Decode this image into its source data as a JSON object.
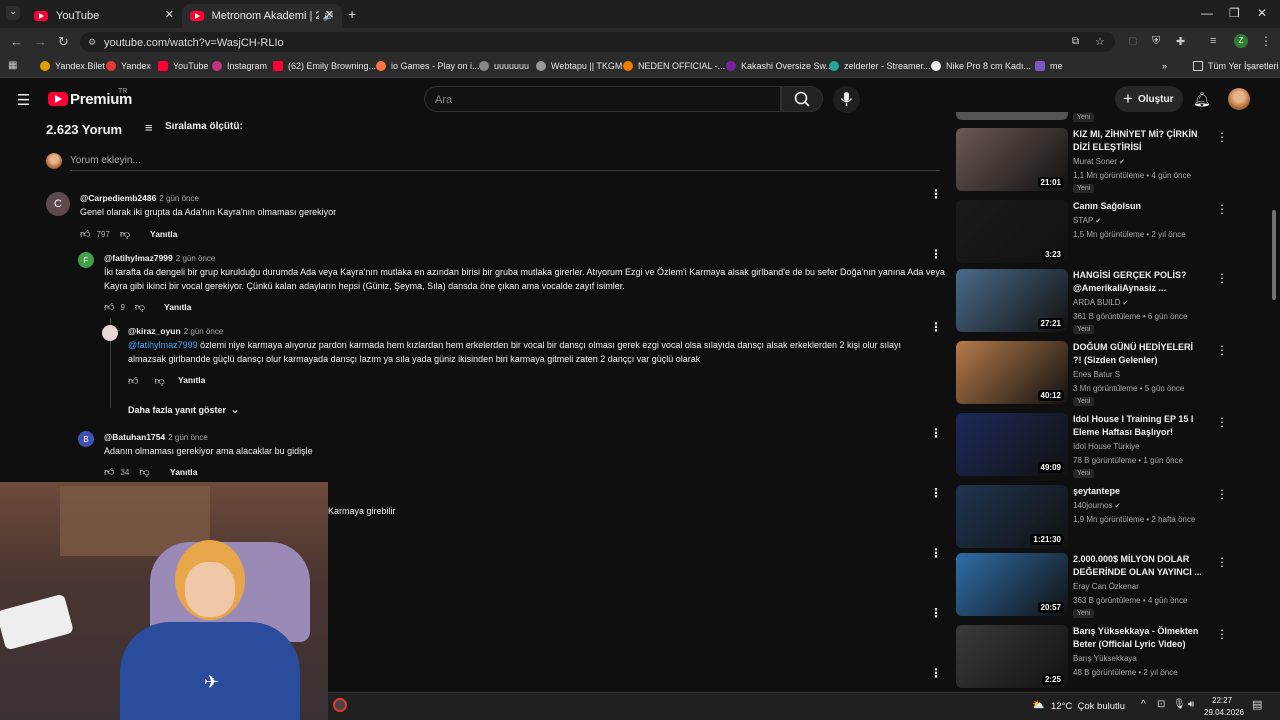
{
  "browser": {
    "tabs": [
      {
        "title": "YouTube"
      },
      {
        "title": "Metronom Akademi | 20. Bö"
      }
    ],
    "url": "youtube.com/watch?v=WasjCH-RLIo",
    "bookmarks": [
      "Yandex.Bilet",
      "Yandex",
      "YouTube",
      "Instagram",
      "(62) Emily Browning...",
      "io Games - Play on i...",
      "uuuuuuu",
      "Webtapu || TKGM",
      "NEDEN OFFICIAL -...",
      "Kakashi Oversize Sw...",
      "zelderler - Streamer...",
      "Nike Pro 8 cm Kadı...",
      "me"
    ],
    "all_bookmarks": "Tüm Yer İşaretleri",
    "profile_letter": "Z"
  },
  "youtube": {
    "logo": "Premium",
    "logo_tr": "TR",
    "search_placeholder": "Ara",
    "create_label": "Oluştur"
  },
  "comments_section": {
    "count_label": "2.623 Yorum",
    "sort_label": "Sıralama ölçütü:",
    "add_placeholder": "Yorum ekleyin...",
    "reply_label": "Yanıtla",
    "more_replies": "Daha fazla yanıt göster",
    "comments": [
      {
        "avatar": "C",
        "handle": "@Carpediemb2486",
        "ago": "2 gün önce",
        "text": "Genel olarak iki grupta da Ada'nın Kayra'nın olmaması gerekiyor",
        "likes": "797",
        "avatar_color": "#5e4a4a"
      },
      {
        "avatar": "F",
        "handle": "@fatihylmaz7999",
        "ago": "2 gün önce",
        "text": "İki tarafta da dengeli bir grup kurulduğu durumda Ada veya Kayra'nın mutlaka en azından birisi bir gruba mutlaka girerler. Atıyorum Ezgi ve Özlem'i Karmaya alsak girlband'e de bu sefer Doğa'nın yanına Ada veya Kayra gibi ikinci bir vocal gerekiyor. Çünkü kalan adayların hepsi (Güniz, Şeyma, Sıla) dansda öne çıkan ama vocalde zayıf isimler.",
        "likes": "9",
        "avatar_color": "#43a047"
      },
      {
        "avatar": "",
        "handle": "@kiraz_oyun",
        "ago": "2 gün önce",
        "mention": "@fatihylmaz7999",
        "text": " özlemi niye karmaya alıyoruz pardon karmada hem kızlardan hem erkelerden bir vocal bir dansçı olması gerek ezgi vocal olsa sılayıda dansçı alsak erkeklerden 2 kişi olur sılayı almazsak girlbandde güçlü dansçı olur karmayada dansçı lazım ya sıla yada güniz ikisinden biri karmaya gitmeli zaten 2 danççı var güçlü olarak",
        "likes": "",
        "avatar_color": "#e8d6d8"
      },
      {
        "avatar": "B",
        "handle": "@Batuhan1754",
        "ago": "2 gün önce",
        "text": "Adanın olmaması gerekiyor ama alacaklar bu gidişle",
        "likes": "34",
        "avatar_color": "#3f51b5"
      }
    ],
    "partial_text": "Karmaya girebilir"
  },
  "sidebar": {
    "videos": [
      {
        "title": "KIZ MI, ZİHNİYET Mİ? ÇİRKİN DİZİ ELEŞTİRİSİ",
        "channel": "Murat Soner",
        "verified": true,
        "meta": "1,1 Mn görüntüleme • 4 gün önce",
        "badge": "Yeni",
        "duration": "21:01",
        "color": "#6b5a52"
      },
      {
        "title": "Canın Sağolsun",
        "channel": "STAP",
        "verified": true,
        "meta": "1,5 Mn görüntüleme • 2 yıl önce",
        "badge": "",
        "duration": "3:23",
        "color": "#1a1a1a"
      },
      {
        "title": "HANGİSİ GERÇEK POLİS? @AmerikaliAynasiz ...",
        "channel": "ARDA BUILD",
        "verified": true,
        "meta": "361 B görüntüleme • 6 gün önce",
        "badge": "Yeni",
        "duration": "27:21",
        "color": "#4a6a8a"
      },
      {
        "title": "DOĞUM GÜNÜ HEDİYELERİ ?! (Sizden Gelenler)",
        "channel": "Enes Batur S",
        "verified": false,
        "meta": "3 Mn görüntüleme • 5 gün önce",
        "badge": "Yeni",
        "duration": "40:12",
        "color": "#b57a4a"
      },
      {
        "title": "Idol House I Training EP 15 I Eleme Haftası Başlıyor!",
        "channel": "Idol House Türkiye",
        "verified": false,
        "meta": "78 B görüntüleme • 1 gün önce",
        "badge": "Yeni",
        "duration": "49:09",
        "color": "#1c2a5a"
      },
      {
        "title": "şeytantepe",
        "channel": "140journos",
        "verified": true,
        "meta": "1,9 Mn görüntüleme • 2 hafta önce",
        "badge": "",
        "duration": "1:21:30",
        "color": "#1f3550"
      },
      {
        "title": "2.000.000$ MİLYON DOLAR DEĞERİNDE OLAN YAYINCI ...",
        "channel": "Eray Can Özkenar",
        "verified": false,
        "meta": "363 B görüntüleme • 4 gün önce",
        "badge": "Yeni",
        "duration": "20:57",
        "color": "#2f6ea8"
      },
      {
        "title": "Barış Yüksekkaya - Ölmekten Beter (Official Lyric Video)",
        "channel": "Barış Yüksekkaya",
        "verified": false,
        "meta": "48 B görüntüleme • 2 yıl önce",
        "badge": "",
        "duration": "2:25",
        "color": "#3a3a3a"
      }
    ]
  },
  "taskbar": {
    "weather": "12°C  Çok bulutlu",
    "time": "22:27",
    "date": "29.04.2026"
  }
}
